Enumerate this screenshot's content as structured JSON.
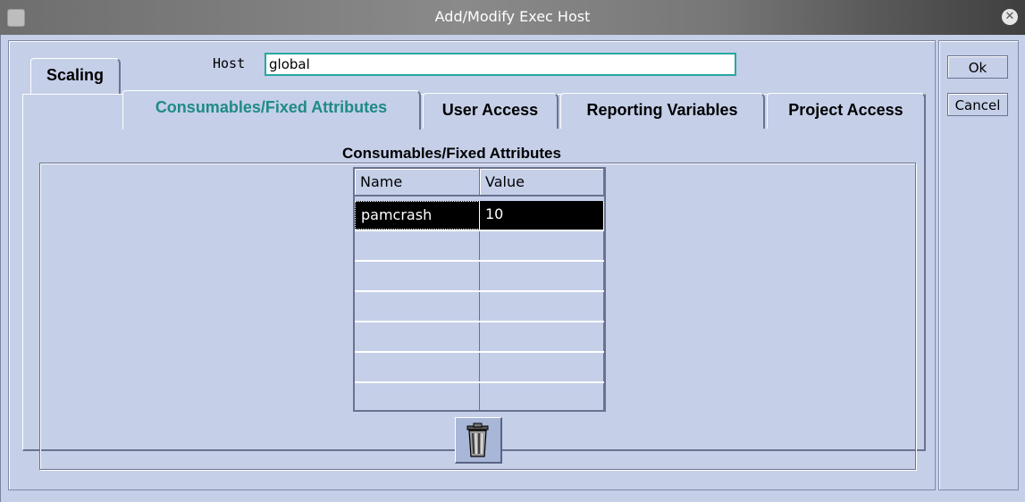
{
  "window": {
    "title": "Add/Modify Exec Host",
    "close_icon": "close-icon",
    "menu_icon": "window-menu-icon"
  },
  "host": {
    "label": "Host",
    "value": "global"
  },
  "tabs": [
    {
      "label": "Scaling",
      "active": false
    },
    {
      "label": "Consumables/Fixed Attributes",
      "active": true
    },
    {
      "label": "User Access",
      "active": false
    },
    {
      "label": "Reporting Variables",
      "active": false
    },
    {
      "label": "Project Access",
      "active": false
    }
  ],
  "group": {
    "title": "Consumables/Fixed Attributes"
  },
  "table": {
    "columns": [
      "Name",
      "Value"
    ],
    "rows": [
      {
        "name": "pamcrash",
        "value": "10",
        "selected": true
      },
      {
        "name": "",
        "value": ""
      },
      {
        "name": "",
        "value": ""
      },
      {
        "name": "",
        "value": ""
      },
      {
        "name": "",
        "value": ""
      },
      {
        "name": "",
        "value": ""
      },
      {
        "name": "",
        "value": ""
      }
    ]
  },
  "actions": {
    "ok_label": "Ok",
    "cancel_label": "Cancel",
    "delete_icon": "trash-icon"
  },
  "colors": {
    "background": "#c5cfe8",
    "active_tab_text": "#1f8a86",
    "input_border": "#2aa6a0",
    "selection": "#000000"
  }
}
